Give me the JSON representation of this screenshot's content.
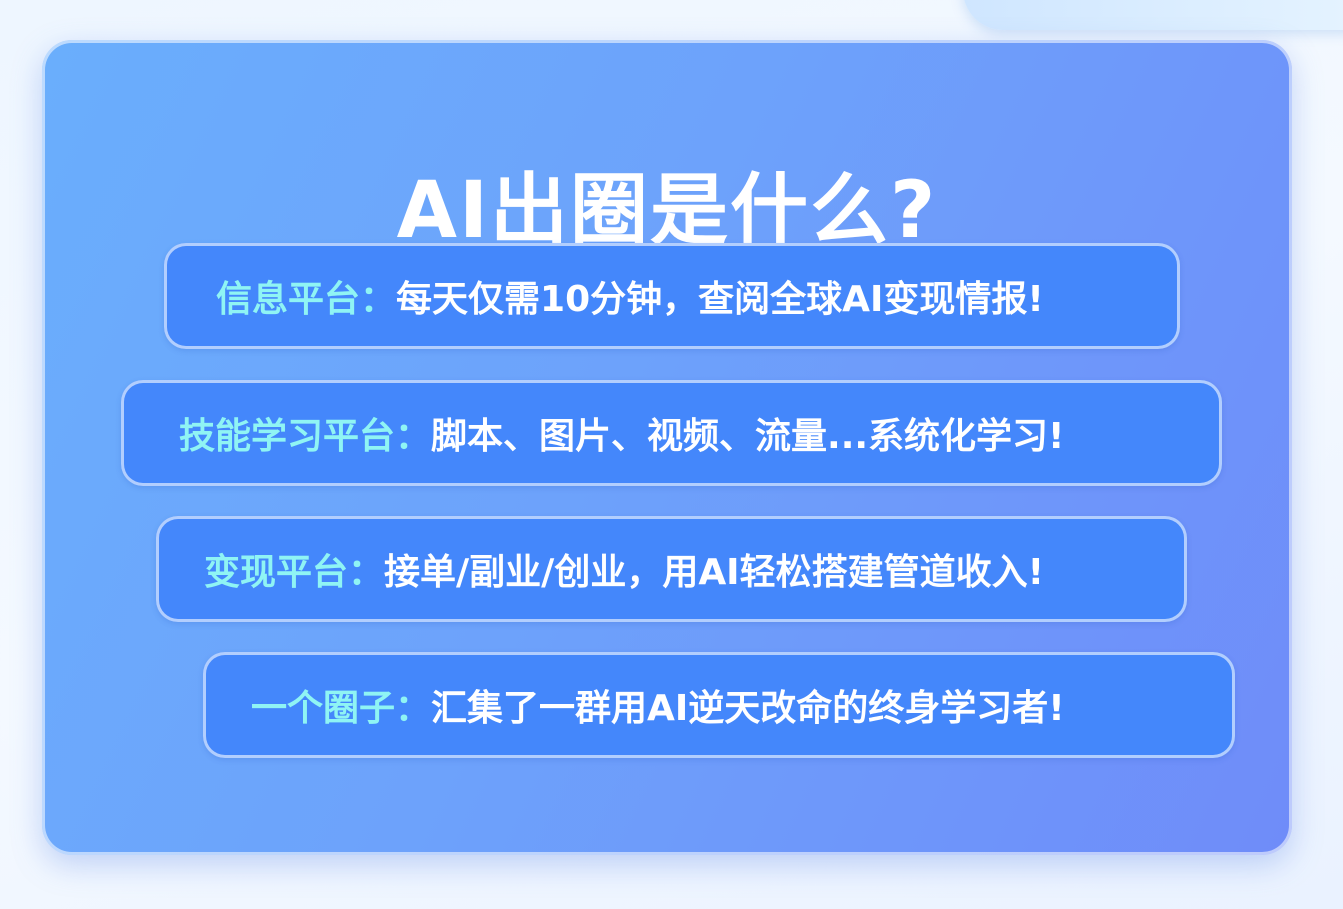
{
  "title": "AI出圈是什么?",
  "rows": [
    {
      "label": "信息平台：",
      "text": "每天仅需10分钟，查阅全球AI变现情报!"
    },
    {
      "label": "技能学习平台：",
      "text": "脚本、图片、视频、流量...系统化学习!"
    },
    {
      "label": "变现平台：",
      "text": "接单/副业/创业，用AI轻松搭建管道收入!"
    },
    {
      "label": "一个圈子：",
      "text": "汇集了一群用AI逆天改命的终身学习者!"
    }
  ],
  "colors": {
    "row_bg": "#4487fb",
    "label": "#8ff4f4",
    "card": "#6da2fb"
  }
}
